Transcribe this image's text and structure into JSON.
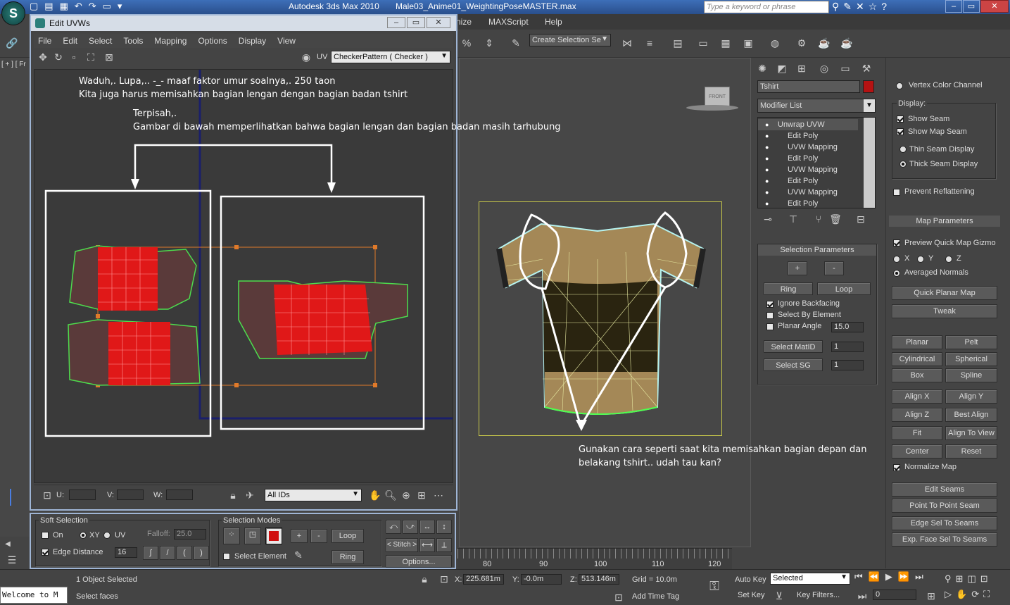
{
  "titlebar": {
    "app": "Autodesk 3ds Max  2010",
    "file": "Male03_Anime01_WeightingPoseMASTER.max",
    "search_placeholder": "Type a keyword or phrase"
  },
  "main_menu": [
    "nize",
    "MAXScript",
    "Help"
  ],
  "toolbar": {
    "selection_set": "Create Selection Se"
  },
  "viewport": {
    "label": "[ + ] [ Fr",
    "cube_label": "FRONT"
  },
  "uvw": {
    "title": "Edit UVWs",
    "menu": [
      "File",
      "Edit",
      "Select",
      "Tools",
      "Mapping",
      "Options",
      "Display",
      "View"
    ],
    "uv_label": "UV",
    "texture": "CheckerPattern  ( Checker )",
    "u_label": "U:",
    "v_label": "V:",
    "w_label": "W:",
    "ids": "All IDs",
    "soft_selection": {
      "title": "Soft Selection",
      "on": "On",
      "xy": "XY",
      "uv": "UV",
      "falloff_label": "Falloff:",
      "falloff": "25.0",
      "edge_distance": "Edge Distance",
      "edge_value": "16"
    },
    "selection_modes": {
      "title": "Selection Modes",
      "loop": "Loop",
      "ring": "Ring",
      "stitch": "< Stitch >",
      "select_element": "Select Element",
      "options": "Options..."
    }
  },
  "annotations": {
    "line1": "Waduh,. Lupa,.. -_- maaf faktor umur soalnya,. 250 taon",
    "line2": "Kita juga harus memisahkan bagian lengan dengan bagian badan tshirt",
    "line3": "Terpisah,.",
    "line4": "Gambar di bawah memperlihatkan bahwa bagian lengan dan bagian badan masih tarhubung",
    "line5": "Gunakan cara seperti saat kita memisahkan bagian depan dan",
    "line6": "belakang tshirt.. udah tau kan?"
  },
  "command_panel": {
    "object_name": "Tshirt",
    "modifier_list": "Modifier List",
    "stack": [
      "Unwrap UVW",
      "Edit Poly",
      "UVW Mapping",
      "Edit Poly",
      "UVW Mapping",
      "Edit Poly",
      "UVW Mapping",
      "Edit Poly"
    ],
    "selection_params": {
      "title": "Selection Parameters",
      "plus": "+",
      "minus": "-",
      "ring": "Ring",
      "loop": "Loop",
      "ignore_backfacing": "Ignore Backfacing",
      "select_by_element": "Select By Element",
      "planar_angle": "Planar Angle",
      "planar_value": "15.0",
      "select_matid": "Select MatID",
      "matid_value": "1",
      "select_sg": "Select SG",
      "sg_value": "1"
    }
  },
  "right_panel": {
    "vertex_color": "Vertex Color Channel",
    "display": "Display:",
    "show_seam": "Show Seam",
    "show_map_seam": "Show Map Seam",
    "thin_seam": "Thin Seam Display",
    "thick_seam": "Thick Seam Display",
    "prevent": "Prevent Reflattening",
    "map_params": "Map Parameters",
    "preview": "Preview Quick Map Gizmo",
    "x": "X",
    "y": "Y",
    "z": "Z",
    "averaged": "Averaged Normals",
    "quick_planar": "Quick Planar Map",
    "tweak": "Tweak",
    "planar": "Planar",
    "pelt": "Pelt",
    "cylindrical": "Cylindrical",
    "spherical": "Spherical",
    "box": "Box",
    "spline": "Spline",
    "align_x": "Align X",
    "align_y": "Align Y",
    "align_z": "Align Z",
    "best_align": "Best Align",
    "fit": "Fit",
    "align_to_view": "Align To View",
    "center": "Center",
    "reset": "Reset",
    "normalize": "Normalize Map",
    "edit_seams": "Edit Seams",
    "point_to_point": "Point To Point Seam",
    "edge_sel": "Edge Sel To Seams",
    "exp_face": "Exp. Face Sel To Seams"
  },
  "timeline": {
    "ticks": [
      "80",
      "90",
      "100",
      "110",
      "120"
    ]
  },
  "status": {
    "welcome": "Welcome to M",
    "objects": "1 Object Selected",
    "prompt": "Select faces",
    "x_label": "X:",
    "x": "225.681m",
    "y_label": "Y:",
    "y": "-0.0m",
    "z_label": "Z:",
    "z": "513.146m",
    "grid": "Grid = 10.0m",
    "add_time_tag": "Add Time Tag",
    "auto_key": "Auto Key",
    "set_key": "Set Key",
    "selected": "Selected",
    "key_filters": "Key Filters...",
    "frame": "0"
  }
}
